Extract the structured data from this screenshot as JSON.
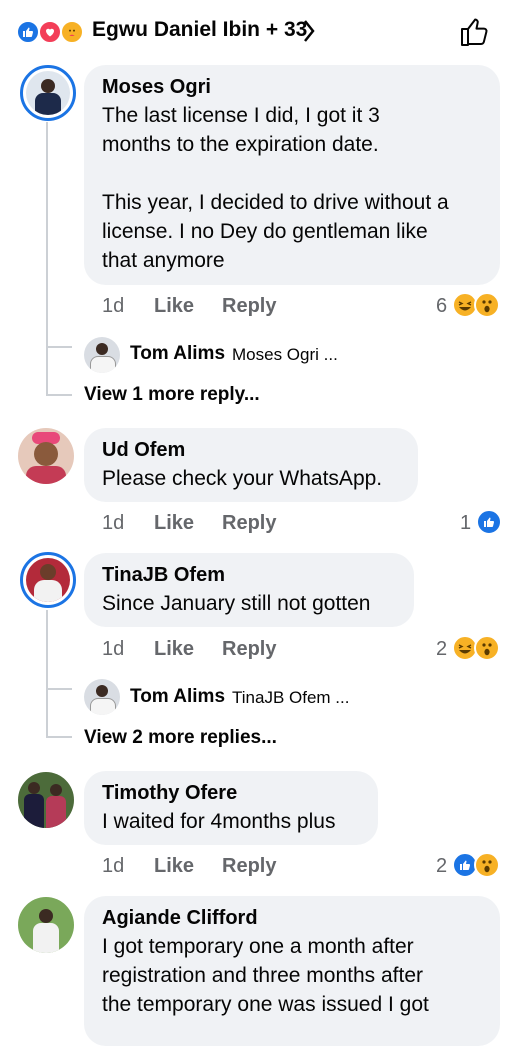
{
  "header": {
    "reactions": [
      "like-icon",
      "love-icon",
      "care-icon"
    ],
    "names": "Egwu Daniel Ibin + 33",
    "chevron": "›"
  },
  "comments": [
    {
      "author": "Moses Ogri",
      "text": "The last license I did, I got it 3\nmonths to the expiration date.\n\nThis year, I decided to drive without a\nlicense. I no Dey do gentleman like\nthat anymore",
      "time": "1d",
      "like": "Like",
      "reply": "Reply",
      "reaction_count": "6",
      "reply_preview": {
        "author": "Tom Alims",
        "text": "Moses Ogri ..."
      },
      "view_more": "View 1 more reply..."
    },
    {
      "author": "Ud Ofem",
      "text": "Please check your WhatsApp.",
      "time": "1d",
      "like": "Like",
      "reply": "Reply",
      "reaction_count": "1"
    },
    {
      "author": "TinaJB Ofem",
      "text": "Since January still not gotten",
      "time": "1d",
      "like": "Like",
      "reply": "Reply",
      "reaction_count": "2",
      "reply_preview": {
        "author": "Tom Alims",
        "text": "TinaJB Ofem ..."
      },
      "view_more": "View 2 more replies..."
    },
    {
      "author": "Timothy Ofere",
      "text": "I waited for 4months plus",
      "time": "1d",
      "like": "Like",
      "reply": "Reply",
      "reaction_count": "2"
    },
    {
      "author": "Agiande Clifford",
      "text": "I got temporary one a month after\nregistration and three months after\nthe temporary one was issued I got"
    }
  ],
  "colors": {
    "accent": "#1b74e4",
    "bubble": "#f0f2f5",
    "secondary_text": "#65676b"
  }
}
